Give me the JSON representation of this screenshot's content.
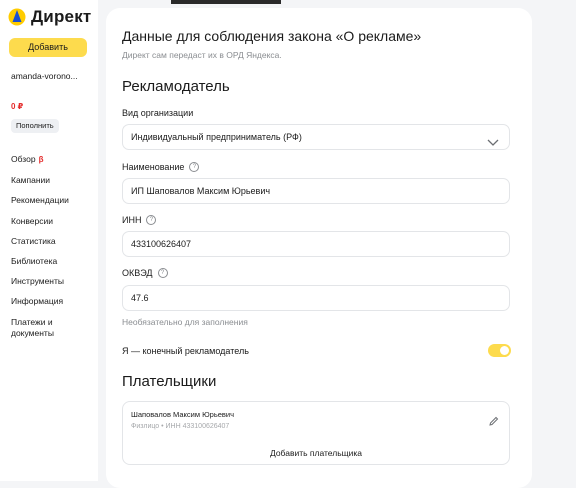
{
  "sidebar": {
    "logo_text": "Директ",
    "add_button": "Добавить",
    "account": "amanda-vorono...",
    "balance": "0 ₽",
    "topup_button": "Пополнить",
    "nav": [
      {
        "label": "Обзор",
        "badge": "β"
      },
      {
        "label": "Кампании"
      },
      {
        "label": "Рекомендации"
      },
      {
        "label": "Конверсии"
      },
      {
        "label": "Статистика"
      },
      {
        "label": "Библиотека"
      },
      {
        "label": "Инструменты"
      },
      {
        "label": "Информация"
      },
      {
        "label": "Платежи и документы"
      }
    ]
  },
  "main": {
    "title": "Данные для соблюдения закона «О рекламе»",
    "subtitle": "Директ сам передаст их в ОРД Яндекса.",
    "advertiser": {
      "section_title": "Рекламодатель",
      "org_type_label": "Вид организации",
      "org_type_value": "Индивидуальный предприниматель (РФ)",
      "name_label": "Наименование",
      "name_value": "ИП Шаповалов Максим Юрьевич",
      "inn_label": "ИНН",
      "inn_value": "433100626407",
      "okved_label": "ОКВЭД",
      "okved_value": "47.6",
      "optional_hint": "Необязательно для заполнения",
      "final_advertiser_label": "Я — конечный рекламодатель",
      "final_advertiser_on": true
    },
    "payers": {
      "section_title": "Плательщики",
      "payer_name": "Шаповалов Максим Юрьевич",
      "payer_meta": "Физлицо • ИНН 433100626407",
      "add_payer": "Добавить плательщика"
    }
  },
  "colors": {
    "accent_yellow": "#fddb4d",
    "alert_red": "#e42b2b",
    "muted_text": "#8a8d91",
    "background": "#f4f5f7"
  }
}
